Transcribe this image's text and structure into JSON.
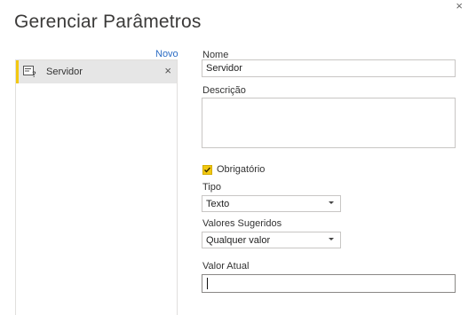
{
  "dialog": {
    "title": "Gerenciar Parâmetros",
    "close_glyph": "×"
  },
  "left": {
    "new_link": "Novo",
    "items": [
      {
        "label": "Servidor",
        "icon": "parameter-icon",
        "remove_glyph": "×",
        "selected": true
      }
    ]
  },
  "form": {
    "name_label": "Nome",
    "name_value": "Servidor",
    "description_label": "Descrição",
    "description_value": "",
    "required_label": "Obrigatório",
    "required_checked": true,
    "type_label": "Tipo",
    "type_value": "Texto",
    "suggested_label": "Valores Sugeridos",
    "suggested_value": "Qualquer valor",
    "current_label": "Valor Atual",
    "current_value": ""
  },
  "colors": {
    "accent": "#f2c811",
    "link": "#2b6cc4",
    "selected_bg": "#e6e6e6"
  }
}
